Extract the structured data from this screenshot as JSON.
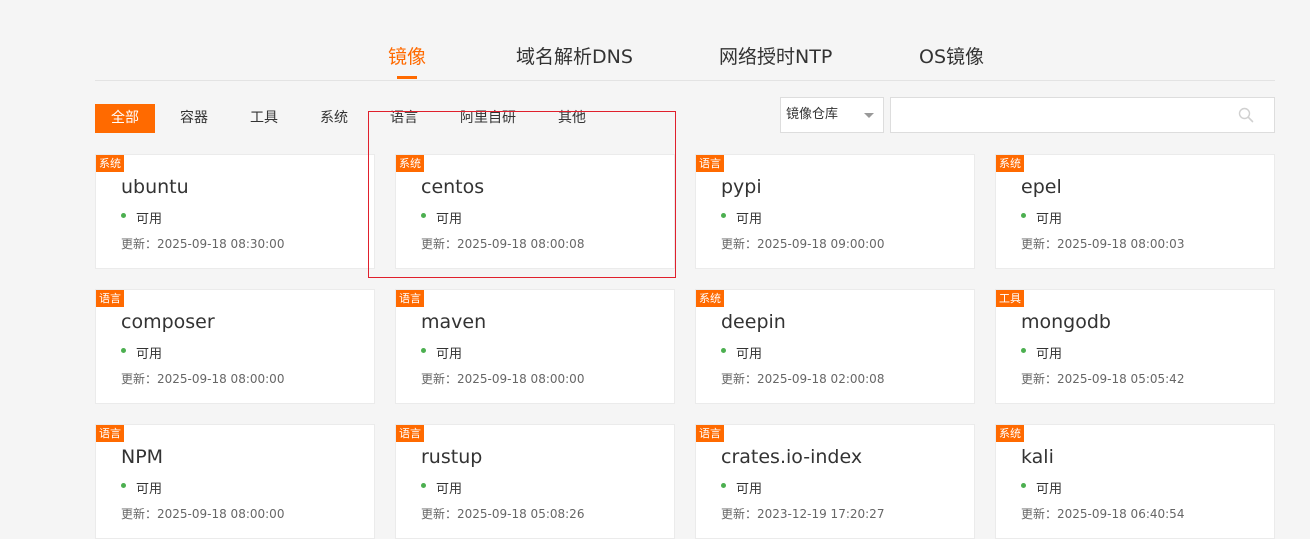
{
  "top_tabs": [
    {
      "label": "镜像",
      "active": true
    },
    {
      "label": "域名解析DNS",
      "active": false
    },
    {
      "label": "网络授时NTP",
      "active": false
    },
    {
      "label": "OS镜像",
      "active": false
    }
  ],
  "filters": [
    {
      "label": "全部",
      "active": true
    },
    {
      "label": "容器"
    },
    {
      "label": "工具"
    },
    {
      "label": "系统"
    },
    {
      "label": "语言"
    },
    {
      "label": "阿里自研"
    },
    {
      "label": "其他"
    }
  ],
  "select": {
    "value": "镜像仓库"
  },
  "search": {
    "value": "",
    "placeholder": ""
  },
  "status_label": "可用",
  "update_prefix": "更新：",
  "accent_color": "#ff6a00",
  "status_color": "#4caf50",
  "cards": [
    {
      "badge": "系统",
      "name": "ubuntu",
      "status": "可用",
      "updated": "更新：2025-09-18 08:30:00"
    },
    {
      "badge": "系统",
      "name": "centos",
      "status": "可用",
      "updated": "更新：2025-09-18 08:00:08"
    },
    {
      "badge": "语言",
      "name": "pypi",
      "status": "可用",
      "updated": "更新：2025-09-18 09:00:00"
    },
    {
      "badge": "系统",
      "name": "epel",
      "status": "可用",
      "updated": "更新：2025-09-18 08:00:03"
    },
    {
      "badge": "语言",
      "name": "composer",
      "status": "可用",
      "updated": "更新：2025-09-18 08:00:00"
    },
    {
      "badge": "语言",
      "name": "maven",
      "status": "可用",
      "updated": "更新：2025-09-18 08:00:00"
    },
    {
      "badge": "系统",
      "name": "deepin",
      "status": "可用",
      "updated": "更新：2025-09-18 02:00:08"
    },
    {
      "badge": "工具",
      "name": "mongodb",
      "status": "可用",
      "updated": "更新：2025-09-18 05:05:42"
    },
    {
      "badge": "语言",
      "name": "NPM",
      "status": "可用",
      "updated": "更新：2025-09-18 08:00:00"
    },
    {
      "badge": "语言",
      "name": "rustup",
      "status": "可用",
      "updated": "更新：2025-09-18 05:08:26"
    },
    {
      "badge": "语言",
      "name": "crates.io-index",
      "status": "可用",
      "updated": "更新：2023-12-19 17:20:27"
    },
    {
      "badge": "系统",
      "name": "kali",
      "status": "可用",
      "updated": "更新：2025-09-18 06:40:54"
    }
  ]
}
